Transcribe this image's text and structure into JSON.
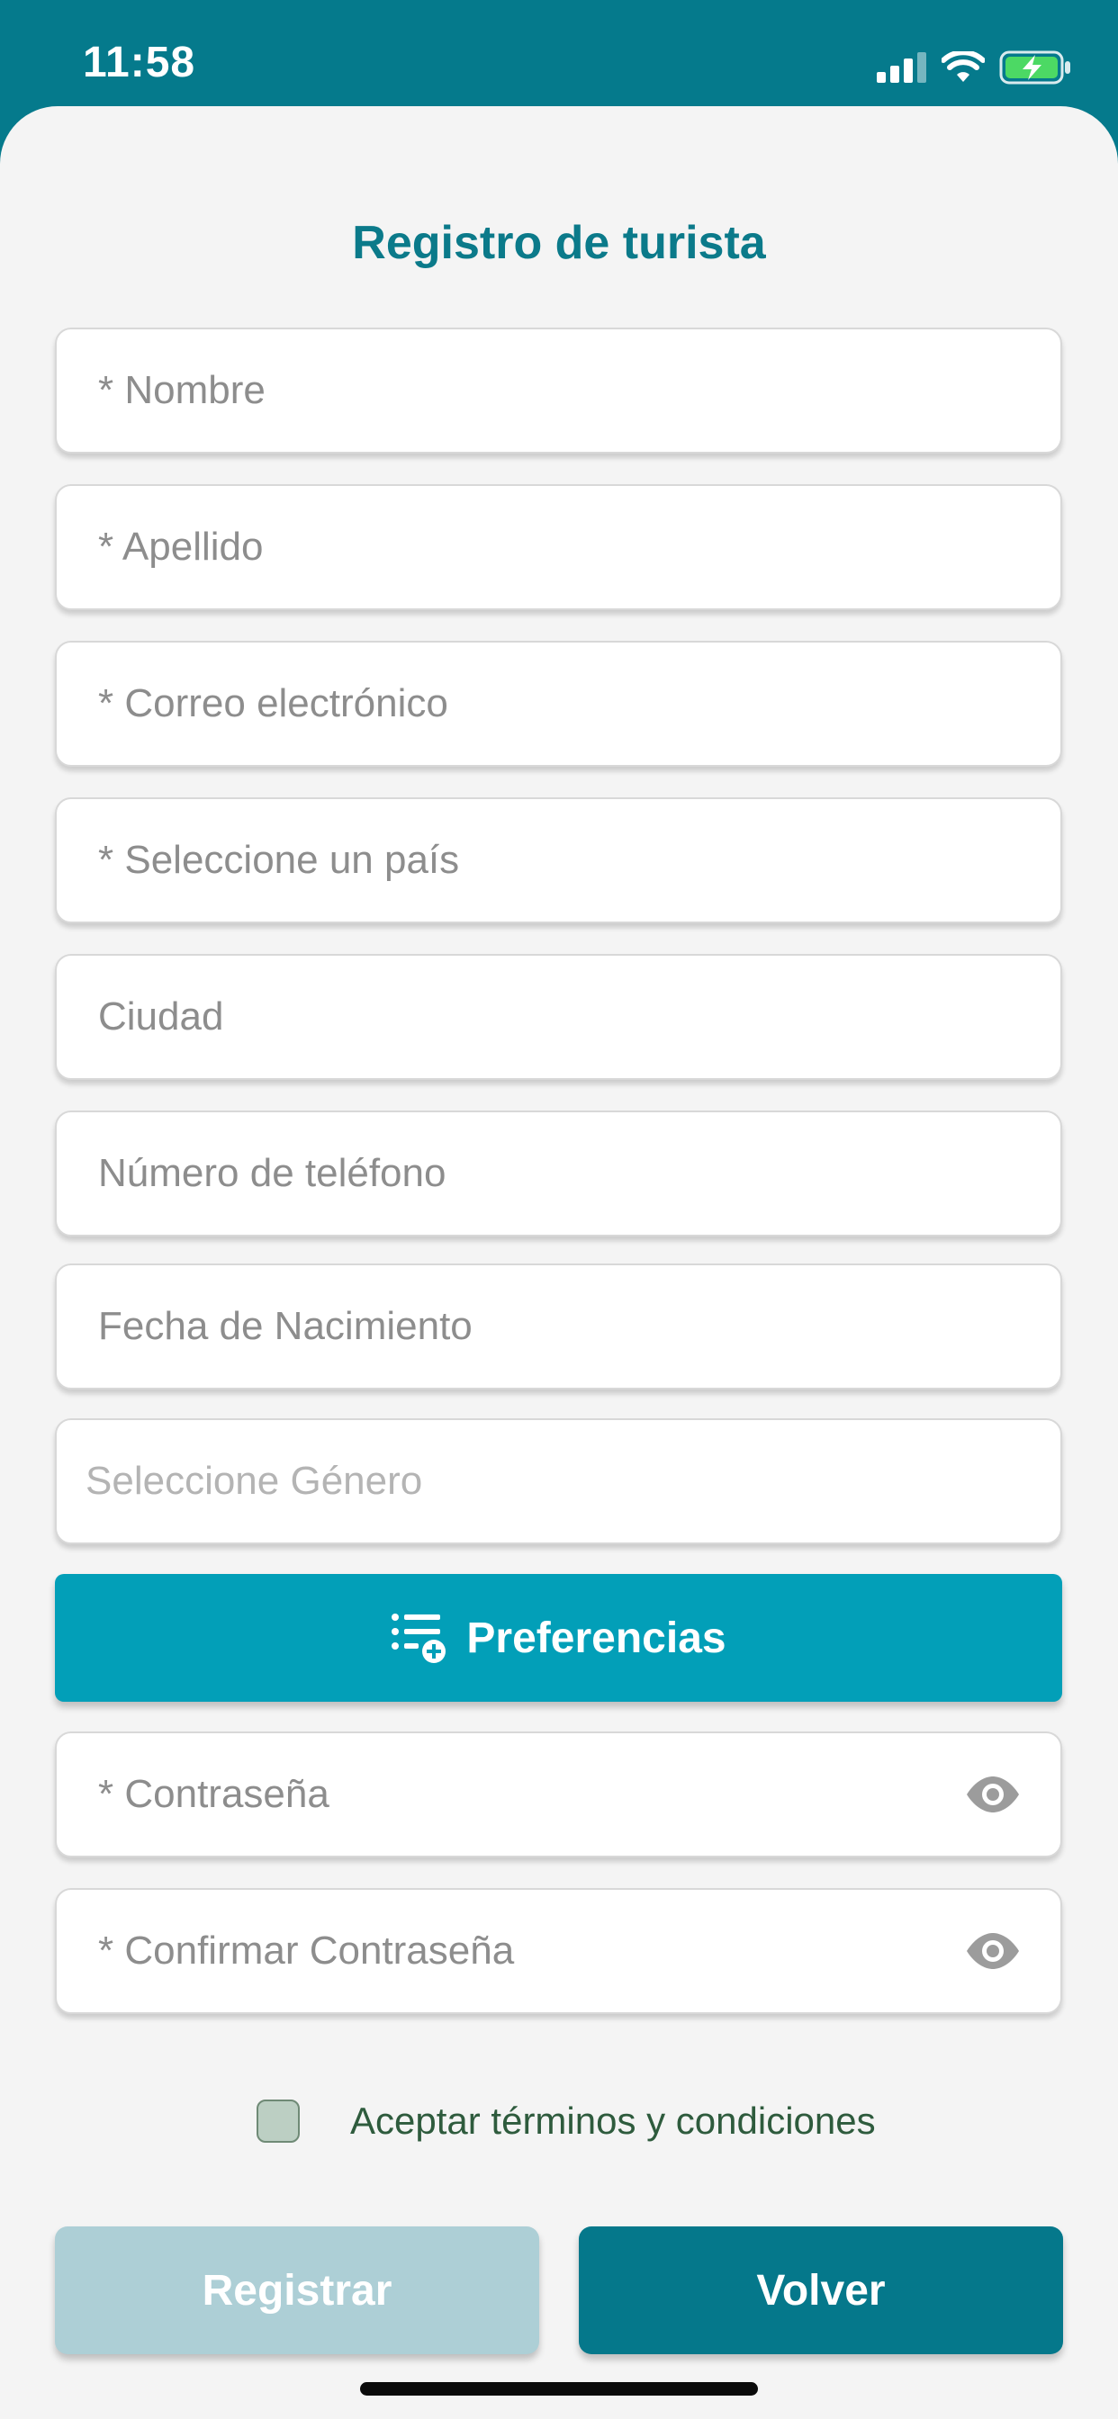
{
  "status_bar": {
    "time": "11:58",
    "icons": [
      "signal-icon",
      "wifi-icon",
      "battery-charging-icon"
    ]
  },
  "page": {
    "title": "Registro de turista"
  },
  "fields": {
    "nombre": "* Nombre",
    "apellido": "* Apellido",
    "correo": "* Correo electrónico",
    "pais": "* Seleccione un país",
    "ciudad": "Ciudad",
    "telefono": "Número de teléfono",
    "fecha_nacimiento": "Fecha de Nacimiento",
    "genero": "Seleccione Género",
    "contrasena": "* Contraseña",
    "confirmar_contrasena": "* Confirmar Contraseña"
  },
  "preferences_button": {
    "label": "Preferencias",
    "icon": "list-add-icon"
  },
  "terms": {
    "label": "Aceptar términos y condiciones",
    "checked": false
  },
  "actions": {
    "register": "Registrar",
    "back": "Volver"
  },
  "colors": {
    "header": "#057a8c",
    "title": "#0b7a8a",
    "preferences": "#029fb8",
    "register_disabled": "#adcfd6",
    "back": "#05788b",
    "battery": "#4cd964"
  }
}
